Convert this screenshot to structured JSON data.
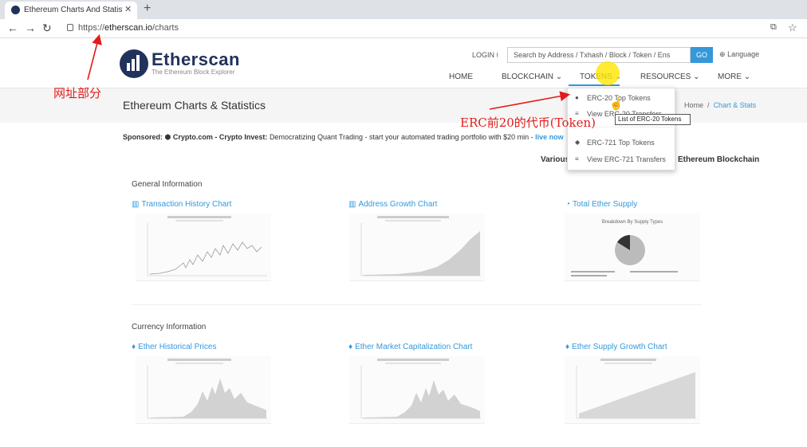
{
  "browser": {
    "tab_title": "Ethereum Charts And Statistics",
    "tab_close": "✕",
    "new_tab": "+",
    "url_prefix": "https://",
    "url_host": "etherscan.io",
    "url_path": "/charts"
  },
  "header": {
    "brand": "Etherscan",
    "tagline": "The Ethereum Block Explorer",
    "login": "LOGIN",
    "search_placeholder": "Search by Address / Txhash / Block / Token / Ens",
    "go": "GO",
    "language": "Language"
  },
  "nav": [
    "HOME",
    "BLOCKCHAIN ⌄",
    "TOKENS ⌄",
    "RESOURCES ⌄",
    "MORE ⌄"
  ],
  "tokens_menu": {
    "items": [
      "ERC-20 Top Tokens",
      "View ERC-20 Transfers",
      "ERC-721 Top Tokens",
      "View ERC-721 Transfers"
    ],
    "tooltip": "List of ERC-20 Tokens"
  },
  "page": {
    "title": "Ethereum Charts & Statistics",
    "breadcrumb_home": "Home",
    "breadcrumb_sep": "/",
    "breadcrumb_current": "Chart & Stats",
    "various_prefix": "Various",
    "various_suffix": "Ethereum Blockchain"
  },
  "sponsor": {
    "label": "Sponsored:",
    "name": "Crypto.com - Crypto Invest:",
    "text": "Democratizing Quant Trading - start your automated trading portfolio with $20 min -",
    "more": "live now"
  },
  "sections": {
    "general": "General Information",
    "currency": "Currency Information"
  },
  "charts": {
    "tx_history": "Transaction History Chart",
    "address_growth": "Address Growth Chart",
    "total_supply": "Total Ether Supply",
    "historical_prices": "Ether Historical Prices",
    "market_cap": "Ether Market Capitalization Chart",
    "supply_growth": "Ether Supply Growth Chart",
    "supply_breakdown_title": "Breakdown By Supply Types"
  },
  "annotations": {
    "url_note": "网址部分",
    "erc20_note": "ERC前20的代币(Token)"
  },
  "colors": {
    "accent": "#3498db",
    "brand": "#21325b",
    "annotation": "#e31b1b"
  }
}
